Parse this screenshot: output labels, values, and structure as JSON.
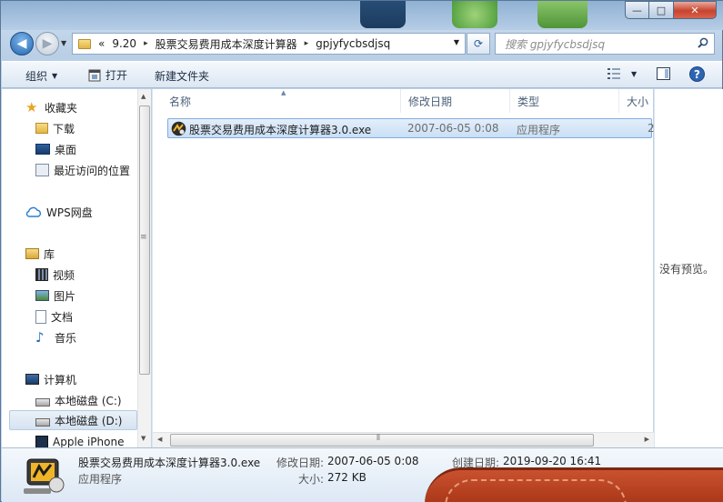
{
  "window": {
    "caption": {
      "minimize": "—",
      "maximize": "□",
      "close": "✕"
    }
  },
  "address": {
    "overflow": "«",
    "segments": [
      "9.20",
      "股票交易费用成本深度计算器",
      "gpjyfycbsdjsq"
    ],
    "search_placeholder": "搜索 gpjyfycbsdjsq"
  },
  "toolbar": {
    "organize": "组织",
    "open": "打开",
    "new_folder": "新建文件夹"
  },
  "navigation": {
    "favorites": "收藏夹",
    "downloads": "下载",
    "desktop": "桌面",
    "recent": "最近访问的位置",
    "wps": "WPS网盘",
    "libraries": "库",
    "videos": "视频",
    "pictures": "图片",
    "documents": "文档",
    "music": "音乐",
    "computer": "计算机",
    "drive_c": "本地磁盘 (C:)",
    "drive_d": "本地磁盘 (D:)",
    "iphone": "Apple iPhone"
  },
  "columns": {
    "name": "名称",
    "modified": "修改日期",
    "type": "类型",
    "size": "大小"
  },
  "files": [
    {
      "name": "股票交易费用成本深度计算器3.0.exe",
      "modified": "2007-06-05 0:08",
      "type": "应用程序",
      "size_partial": "2"
    }
  ],
  "preview": {
    "empty_text": "没有预览。"
  },
  "details": {
    "name": "股票交易费用成本深度计算器3.0.exe",
    "type": "应用程序",
    "modified_label": "修改日期:",
    "modified_value": "2007-06-05 0:08",
    "size_label": "大小:",
    "size_value": "272 KB",
    "created_label": "创建日期:",
    "created_value": "2019-09-20 16:41"
  },
  "colors": {
    "selection_bg": "#cadff5",
    "selection_border": "#84acdd",
    "header_text": "#4c607a",
    "close_red": "#c7442f"
  }
}
